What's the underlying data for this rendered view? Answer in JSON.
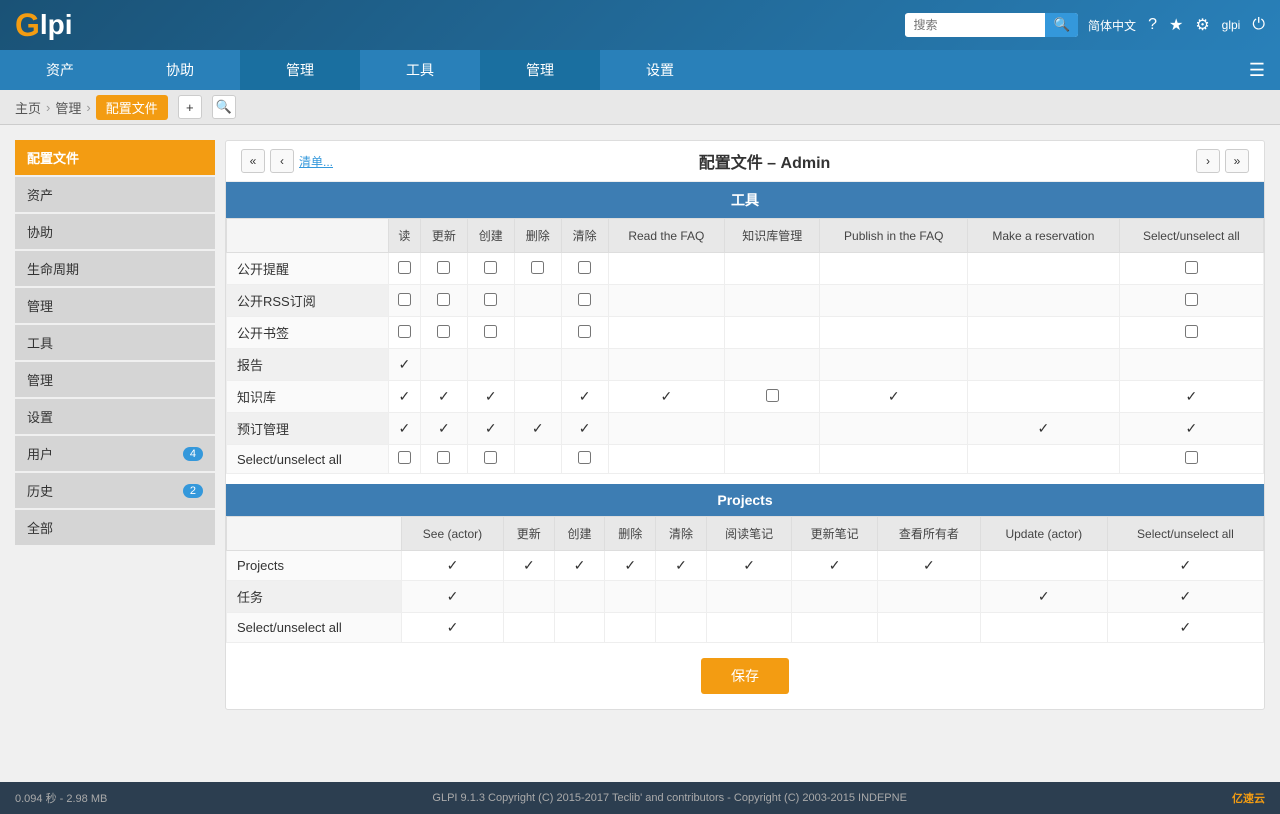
{
  "header": {
    "logo_g": "G",
    "logo_lpi": "lpi",
    "search_placeholder": "搜索",
    "lang": "简体中文",
    "username": "glpi",
    "icons": {
      "question": "?",
      "star": "★",
      "gear": "⚙",
      "power": "⏻"
    }
  },
  "nav": {
    "items": [
      "资产",
      "协助",
      "管理",
      "工具",
      "管理",
      "设置"
    ]
  },
  "breadcrumb": {
    "home": "主页",
    "admin": "管理",
    "config": "配置文件"
  },
  "sidebar": {
    "items": [
      {
        "label": "配置文件",
        "badge": null,
        "active": true
      },
      {
        "label": "资产",
        "badge": null
      },
      {
        "label": "协助",
        "badge": null
      },
      {
        "label": "生命周期",
        "badge": null
      },
      {
        "label": "管理",
        "badge": null
      },
      {
        "label": "工具",
        "badge": null
      },
      {
        "label": "管理",
        "badge": null
      },
      {
        "label": "设置",
        "badge": null
      },
      {
        "label": "用户",
        "badge": "4"
      },
      {
        "label": "历史",
        "badge": "2"
      },
      {
        "label": "全部",
        "badge": null
      }
    ]
  },
  "profile": {
    "title": "配置文件 – Admin",
    "nav_link": "清单..."
  },
  "sections": {
    "tools": {
      "header": "工具",
      "columns": [
        "读",
        "更新",
        "创建",
        "删除",
        "清除",
        "Read the FAQ",
        "知识库管理",
        "Publish in the FAQ",
        "Make a reservation",
        "Select/unselect all"
      ],
      "rows": [
        {
          "label": "公开提醒",
          "values": [
            "checkbox",
            "checkbox",
            "checkbox",
            "checkbox",
            "checkbox",
            "",
            "",
            "",
            "",
            "checkbox"
          ]
        },
        {
          "label": "公开RSS订阅",
          "values": [
            "checkbox",
            "checkbox",
            "checkbox",
            "checkbox",
            "checkbox",
            "",
            "",
            "",
            "",
            "checkbox"
          ]
        },
        {
          "label": "公开书签",
          "values": [
            "checkbox",
            "checkbox",
            "checkbox",
            "checkbox",
            "checkbox",
            "",
            "",
            "",
            "",
            "checkbox"
          ]
        },
        {
          "label": "报告",
          "values": [
            "check",
            "",
            "",
            "",
            "",
            "",
            "",
            "",
            "",
            ""
          ]
        },
        {
          "label": "知识库",
          "values": [
            "check",
            "check",
            "check",
            "",
            "check",
            "check",
            "checkbox",
            "check",
            "",
            "check"
          ]
        },
        {
          "label": "预订管理",
          "values": [
            "check",
            "check",
            "check",
            "check",
            "check",
            "",
            "",
            "",
            "check",
            "check"
          ]
        },
        {
          "label": "Select/unselect all",
          "values": [
            "checkbox",
            "checkbox",
            "checkbox",
            "checkbox",
            "checkbox",
            "",
            "",
            "",
            "",
            "checkbox"
          ]
        }
      ]
    },
    "projects": {
      "header": "Projects",
      "columns": [
        "See (actor)",
        "更新",
        "创建",
        "删除",
        "清除",
        "阅读笔记",
        "更新笔记",
        "查看所有者",
        "Update (actor)",
        "Select/unselect all"
      ],
      "rows": [
        {
          "label": "Projects",
          "values": [
            "check",
            "check",
            "check",
            "check",
            "check",
            "check",
            "check",
            "check",
            "",
            "check"
          ]
        },
        {
          "label": "任务",
          "values": [
            "check",
            "",
            "",
            "",
            "",
            "",
            "",
            "",
            "check",
            "check"
          ]
        },
        {
          "label": "Select/unselect all",
          "values": [
            "check",
            "",
            "",
            "",
            "",
            "",
            "",
            "",
            "",
            "check"
          ]
        }
      ]
    }
  },
  "save_button": "保存",
  "footer": {
    "perf": "0.094 秒 - 2.98 MB",
    "copyright": "GLPI 9.1.3 Copyright (C) 2015-2017 Teclib' and contributors - Copyright (C) 2003-2015 INDEPNE",
    "logo": "亿速云"
  }
}
